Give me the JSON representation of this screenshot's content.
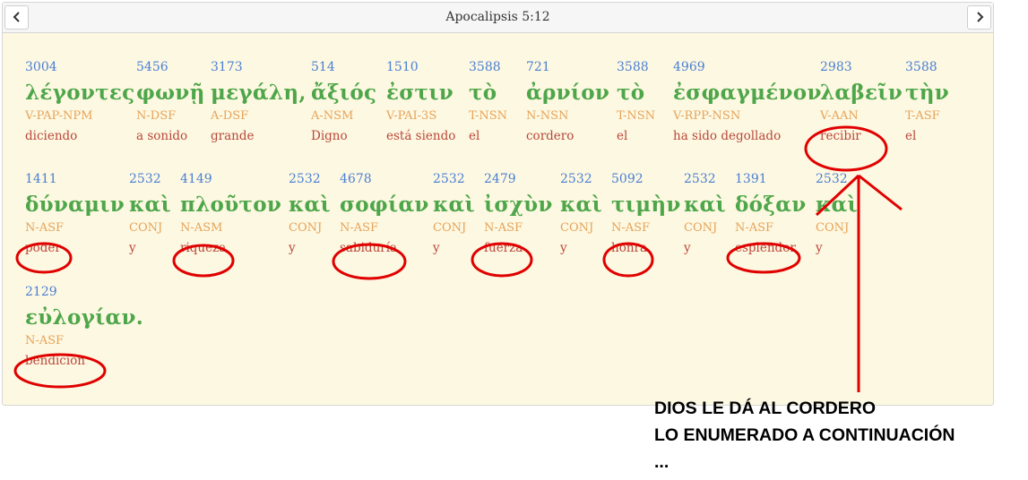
{
  "header": {
    "title": "Apocalipsis 5:12",
    "prev_icon": "chevron-left",
    "next_icon": "chevron-right"
  },
  "words": [
    {
      "num": "3004",
      "greek": "λέγοντες",
      "morph": "V-PAP-NPM",
      "gloss": "diciendo"
    },
    {
      "num": "5456",
      "greek": "φωνῇ",
      "morph": "N-DSF",
      "gloss": "a sonido"
    },
    {
      "num": "3173",
      "greek": "μεγάλη,",
      "morph": "A-DSF",
      "gloss": "grande"
    },
    {
      "num": "514",
      "greek": "ἄξιός",
      "morph": "A-NSM",
      "gloss": "Digno"
    },
    {
      "num": "1510",
      "greek": "ἐστιν",
      "morph": "V-PAI-3S",
      "gloss": "está siendo"
    },
    {
      "num": "3588",
      "greek": "τὸ",
      "morph": "T-NSN",
      "gloss": "el"
    },
    {
      "num": "721",
      "greek": "ἀρνίον",
      "morph": "N-NSN",
      "gloss": "cordero"
    },
    {
      "num": "3588",
      "greek": "τὸ",
      "morph": "T-NSN",
      "gloss": "el"
    },
    {
      "num": "4969",
      "greek": "ἐσφαγμένον",
      "morph": "V-RPP-NSN",
      "gloss": "ha sido degollado"
    },
    {
      "num": "2983",
      "greek": "λαβεῖν",
      "morph": "V-AAN",
      "gloss": "recibir"
    },
    {
      "num": "3588",
      "greek": "τὴν",
      "morph": "T-ASF",
      "gloss": "el"
    },
    {
      "num": "1411",
      "greek": "δύναμιν",
      "morph": "N-ASF",
      "gloss": "poder"
    },
    {
      "num": "2532",
      "greek": "καὶ",
      "morph": "CONJ",
      "gloss": "y"
    },
    {
      "num": "4149",
      "greek": "πλοῦτον",
      "morph": "N-ASM",
      "gloss": "riqueza"
    },
    {
      "num": "2532",
      "greek": "καὶ",
      "morph": "CONJ",
      "gloss": "y"
    },
    {
      "num": "4678",
      "greek": "σοφίαν",
      "morph": "N-ASF",
      "gloss": "sabiduría"
    },
    {
      "num": "2532",
      "greek": "καὶ",
      "morph": "CONJ",
      "gloss": "y"
    },
    {
      "num": "2479",
      "greek": "ἰσχὺν",
      "morph": "N-ASF",
      "gloss": "fuerza"
    },
    {
      "num": "2532",
      "greek": "καὶ",
      "morph": "CONJ",
      "gloss": "y"
    },
    {
      "num": "5092",
      "greek": "τιμὴν",
      "morph": "N-ASF",
      "gloss": "honra"
    },
    {
      "num": "2532",
      "greek": "καὶ",
      "morph": "CONJ",
      "gloss": "y"
    },
    {
      "num": "1391",
      "greek": "δόξαν",
      "morph": "N-ASF",
      "gloss": "esplendor"
    },
    {
      "num": "2532",
      "greek": "καὶ",
      "morph": "CONJ",
      "gloss": "y"
    },
    {
      "num": "2129",
      "greek": "εὐλογίαν.",
      "morph": "N-ASF",
      "gloss": "bendición"
    }
  ],
  "annotation": {
    "lines": [
      "DIOS LE DÁ AL CORDERO",
      "LO ENUMERADO A CONTINUACIÓN",
      "..."
    ],
    "color": "#e00000"
  }
}
